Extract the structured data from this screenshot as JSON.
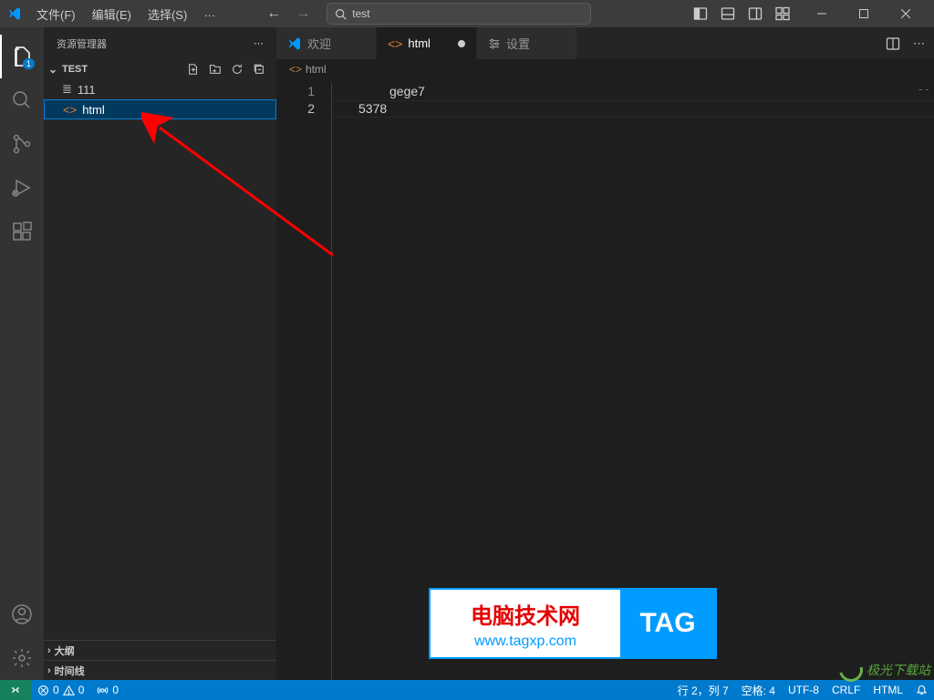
{
  "titlebar": {
    "menu": [
      "文件(F)",
      "编辑(E)",
      "选择(S)"
    ],
    "more": "…",
    "search_value": "test"
  },
  "activity": {
    "explorer_badge": "1"
  },
  "sidebar": {
    "title": "资源管理器",
    "section": "TEST",
    "items": [
      {
        "name": "111",
        "icon": "≣",
        "selected": false
      },
      {
        "name": "html",
        "icon": "<>",
        "selected": true
      }
    ],
    "outline": "大纲",
    "timeline": "时间线"
  },
  "tabs": [
    {
      "label": "欢迎",
      "kind": "welcome",
      "active": false,
      "dirty": false
    },
    {
      "label": "html",
      "kind": "html",
      "active": true,
      "dirty": true
    },
    {
      "label": "设置",
      "kind": "settings",
      "active": false,
      "dirty": false
    }
  ],
  "breadcrumb": {
    "label": "html"
  },
  "code": {
    "lines": [
      "gege7",
      "5378"
    ],
    "end_marker": "--"
  },
  "status": {
    "errors": "0",
    "warnings": "0",
    "ports": "0",
    "cursor": "行 2，列 7",
    "spaces": "空格: 4",
    "encoding": "UTF-8",
    "eol": "CRLF",
    "language": "HTML"
  },
  "watermark1": {
    "line1": "电脑技术网",
    "line2": "www.tagxp.com",
    "tag": "TAG"
  },
  "watermark2": {
    "text": "极光下载站"
  }
}
